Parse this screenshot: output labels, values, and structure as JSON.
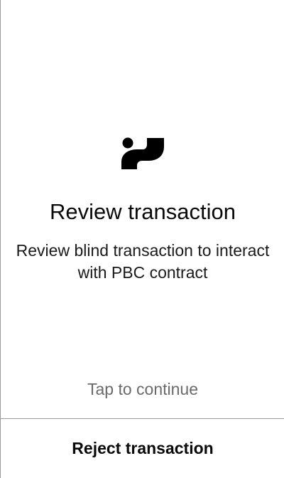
{
  "screen": {
    "logo_icon": "app-logo-icon",
    "title": "Review transaction",
    "description": "Review blind transaction to interact with PBC contract",
    "tap_hint": "Tap to continue"
  },
  "actions": {
    "reject_label": "Reject transaction"
  },
  "colors": {
    "background": "#ffffff",
    "text": "#111111",
    "hint": "#6a6a6a",
    "divider": "#9a9a9a"
  }
}
